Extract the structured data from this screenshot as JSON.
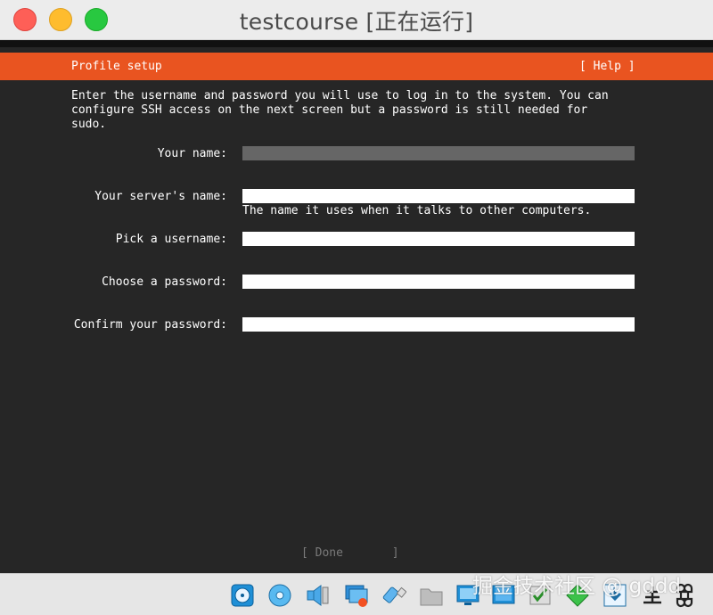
{
  "window": {
    "title": "testcourse [正在运行]"
  },
  "header": {
    "title": "Profile setup",
    "help_label": "[ Help ]"
  },
  "intro_text": "Enter the username and password you will use to log in to the system. You can\nconfigure SSH access on the next screen but a password is still needed for\nsudo.",
  "form": {
    "your_name_label": "Your name:",
    "your_name_value": "",
    "server_name_label": "Your server's name:",
    "server_name_value": "",
    "server_name_hint": "The name it uses when it talks to other computers.",
    "username_label": "Pick a username:",
    "username_value": "",
    "password_label": "Choose a password:",
    "password_value": "",
    "confirm_label": "Confirm your password:",
    "confirm_value": ""
  },
  "footer": {
    "done_label": "[ Done       ]"
  },
  "watermark": "掘金技术社区 @ gddd",
  "statusbar": {
    "icons": [
      "hard-disk-icon",
      "optical-disk-icon",
      "audio-icon",
      "network-icon",
      "usb-icon",
      "shared-folder-icon",
      "display-icon",
      "video-capture-icon",
      "cpu-icon",
      "recording-icon",
      "download-icon",
      "host-key-icon",
      "command-key-icon"
    ]
  }
}
